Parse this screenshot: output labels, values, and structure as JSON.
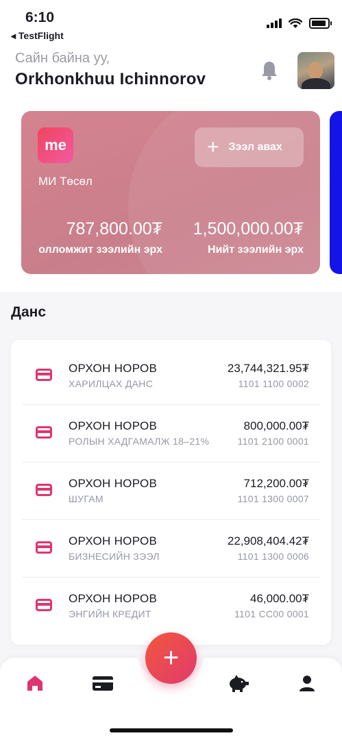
{
  "status_bar": {
    "time": "6:10",
    "back_app": "◂ TestFlight"
  },
  "header": {
    "greeting": "Сайн байна уу,",
    "user_name": "Orkhonkhuu Ichinnorov"
  },
  "loan_card": {
    "logo_text": "me",
    "title": "МИ Төсөл",
    "button_label": "Зээл авах",
    "available_amount": "787,800.00₮",
    "available_label": "олломжит зээлийн эрх",
    "total_amount": "1,500,000.00₮",
    "total_label": "Нийт зээлийн эрх"
  },
  "accounts": {
    "title": "Данс",
    "items": [
      {
        "holder": "ОРХОН НОРОВ",
        "type": "ХАРИЛЦАХ ДАНС",
        "balance": "23,744,321.95₮",
        "number": "1101 1100 0002"
      },
      {
        "holder": "ОРХОН НОРОВ",
        "type": "РОЛЫН ХАДГАМАЛЖ 18–21%",
        "balance": "800,000.00₮",
        "number": "1101 2100 0001"
      },
      {
        "holder": "ОРХОН НОРОВ",
        "type": "ШУГАМ",
        "balance": "712,200.00₮",
        "number": "1101 1300 0007"
      },
      {
        "holder": "ОРХОН НОРОВ",
        "type": "БИЗНЕСИЙН ЗЭЭЛ",
        "balance": "22,908,404.42₮",
        "number": "1101 1300 0006"
      },
      {
        "holder": "ОРХОН НОРОВ",
        "type": "ЭНГИЙН КРЕДИТ",
        "balance": "46,000.00₮",
        "number": "1101 CC00 0001"
      }
    ]
  },
  "tab_bar": {
    "fab_symbol": "+",
    "tabs": [
      "home-icon",
      "card-icon",
      "piggy-bank-icon",
      "profile-icon"
    ],
    "active_color": "#e0346f"
  },
  "colors": {
    "accent": "#e0346f",
    "loan_card": "#cf838f",
    "second_card": "#1514e8"
  }
}
